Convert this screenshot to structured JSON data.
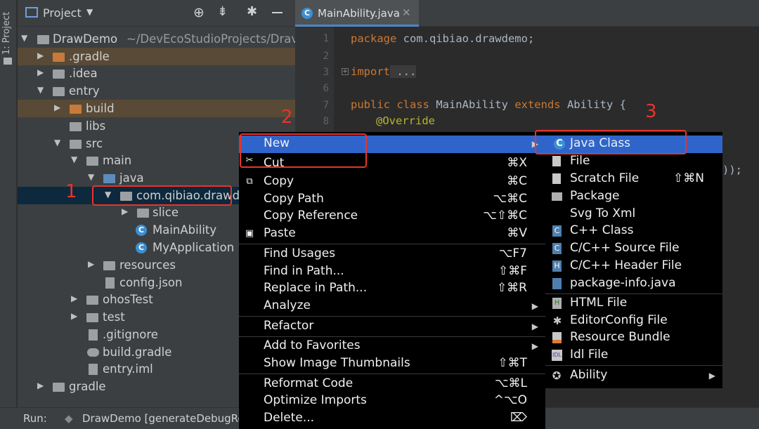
{
  "tool_strip": {
    "label": "1: Project"
  },
  "project_panel": {
    "title": "Project"
  },
  "tree": [
    {
      "label": "DrawDemo",
      "extra": "~/DevEcoStudioProjects/Drav"
    },
    {
      "label": ".gradle"
    },
    {
      "label": ".idea"
    },
    {
      "label": "entry"
    },
    {
      "label": "build"
    },
    {
      "label": "libs"
    },
    {
      "label": "src"
    },
    {
      "label": "main"
    },
    {
      "label": "java"
    },
    {
      "label": "com.qibiao.drawd"
    },
    {
      "label": "slice"
    },
    {
      "label": "MainAbility"
    },
    {
      "label": "MyApplication"
    },
    {
      "label": "resources"
    },
    {
      "label": "config.json"
    },
    {
      "label": "ohosTest"
    },
    {
      "label": "test"
    },
    {
      "label": ".gitignore"
    },
    {
      "label": "build.gradle"
    },
    {
      "label": "entry.iml"
    },
    {
      "label": "gradle"
    }
  ],
  "editor": {
    "tab_label": "MainAbility.java",
    "line_numbers": [
      "1",
      "2",
      "3",
      "6",
      "7",
      "8"
    ],
    "code": {
      "l1_kw": "package",
      "l1_rest": " com.qibiao.drawdemo;",
      "l3_kw": "import",
      "l3_rest": " ...",
      "l7_kw1": "public class",
      "l7_mid": " MainAbility ",
      "l7_kw2": "extends",
      "l7_rest": " Ability {",
      "l8": "@Override",
      "trailing": "));"
    }
  },
  "run_bar": {
    "label": "Run:",
    "config": "DrawDemo [generateDebugRe"
  },
  "context_menu": {
    "items": [
      {
        "label": "New",
        "shortcut": "",
        "submenu": true
      },
      {
        "label": "Cut",
        "shortcut": "⌘X"
      },
      {
        "label": "Copy",
        "shortcut": "⌘C"
      },
      {
        "label": "Copy Path",
        "shortcut": "⌥⌘C"
      },
      {
        "label": "Copy Reference",
        "shortcut": "⌥⇧⌘C"
      },
      {
        "label": "Paste",
        "shortcut": "⌘V"
      },
      {
        "label": "Find Usages",
        "shortcut": "⌥F7"
      },
      {
        "label": "Find in Path...",
        "shortcut": "⇧⌘F"
      },
      {
        "label": "Replace in Path...",
        "shortcut": "⇧⌘R"
      },
      {
        "label": "Analyze",
        "shortcut": "",
        "submenu": true
      },
      {
        "label": "Refactor",
        "shortcut": "",
        "submenu": true
      },
      {
        "label": "Add to Favorites",
        "shortcut": "",
        "submenu": true
      },
      {
        "label": "Show Image Thumbnails",
        "shortcut": "⇧⌘T"
      },
      {
        "label": "Reformat Code",
        "shortcut": "⌥⌘L"
      },
      {
        "label": "Optimize Imports",
        "shortcut": "^⌥O"
      },
      {
        "label": "Delete...",
        "shortcut": "⌦"
      }
    ]
  },
  "new_submenu": {
    "items": [
      {
        "label": "Java Class",
        "shortcut": ""
      },
      {
        "label": "File",
        "shortcut": ""
      },
      {
        "label": "Scratch File",
        "shortcut": "⇧⌘N"
      },
      {
        "label": "Package",
        "shortcut": ""
      },
      {
        "label": "Svg To Xml",
        "shortcut": ""
      },
      {
        "label": "C++ Class",
        "shortcut": ""
      },
      {
        "label": "C/C++ Source File",
        "shortcut": ""
      },
      {
        "label": "C/C++ Header File",
        "shortcut": ""
      },
      {
        "label": "package-info.java",
        "shortcut": ""
      },
      {
        "label": "HTML File",
        "shortcut": ""
      },
      {
        "label": "EditorConfig File",
        "shortcut": ""
      },
      {
        "label": "Resource Bundle",
        "shortcut": ""
      },
      {
        "label": "Idl File",
        "shortcut": ""
      },
      {
        "label": "Ability",
        "shortcut": ""
      }
    ]
  },
  "annotations": {
    "n1": "1",
    "n2": "2",
    "n3": "3"
  },
  "colors": {
    "selection": "#2f65ca",
    "annotation_red": "#e8342c",
    "background": "#2b2b2b"
  }
}
